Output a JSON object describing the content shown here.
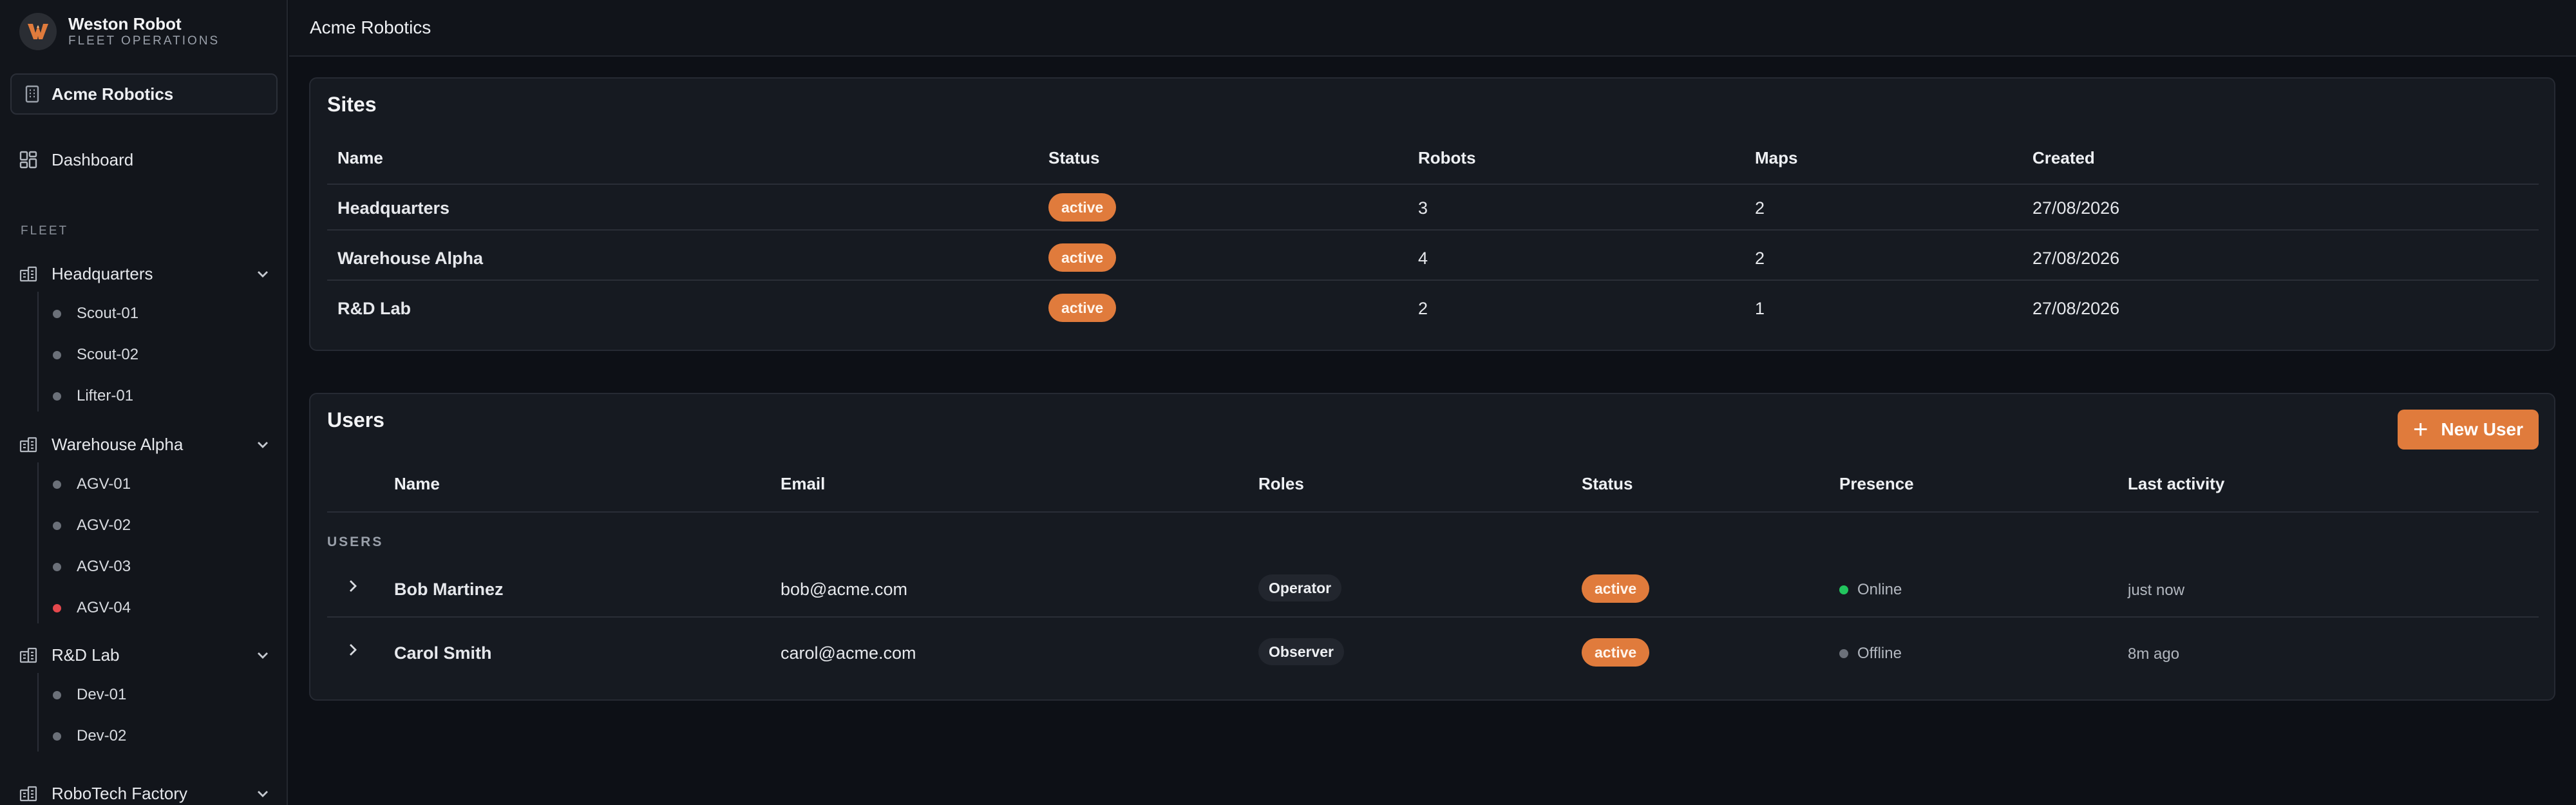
{
  "brand": {
    "name": "Weston Robot",
    "subtitle": "FLEET OPERATIONS",
    "logo_icon": "weston-logo-icon"
  },
  "org_switcher": {
    "label": "Acme Robotics",
    "icon": "building-icon"
  },
  "nav": {
    "dashboard": "Dashboard"
  },
  "sidebar": {
    "section_label": "FLEET",
    "groups": [
      {
        "label": "Headquarters",
        "robots": [
          {
            "label": "Scout-01",
            "status_color": "#6b7079"
          },
          {
            "label": "Scout-02",
            "status_color": "#6b7079"
          },
          {
            "label": "Lifter-01",
            "status_color": "#6b7079"
          }
        ]
      },
      {
        "label": "Warehouse Alpha",
        "robots": [
          {
            "label": "AGV-01",
            "status_color": "#6b7079"
          },
          {
            "label": "AGV-02",
            "status_color": "#6b7079"
          },
          {
            "label": "AGV-03",
            "status_color": "#6b7079"
          },
          {
            "label": "AGV-04",
            "status_color": "#e5484d"
          }
        ]
      },
      {
        "label": "R&D Lab",
        "robots": [
          {
            "label": "Dev-01",
            "status_color": "#6b7079"
          },
          {
            "label": "Dev-02",
            "status_color": "#6b7079"
          }
        ]
      },
      {
        "label": "RoboTech Factory",
        "robots": []
      }
    ]
  },
  "header": {
    "breadcrumb": "Acme Robotics"
  },
  "sites": {
    "title": "Sites",
    "columns": [
      "Name",
      "Status",
      "Robots",
      "Maps",
      "Created"
    ],
    "rows": [
      {
        "name": "Headquarters",
        "status": "active",
        "robots": "3",
        "maps": "2",
        "created": "27/08/2026"
      },
      {
        "name": "Warehouse Alpha",
        "status": "active",
        "robots": "4",
        "maps": "2",
        "created": "27/08/2026"
      },
      {
        "name": "R&D Lab",
        "status": "active",
        "robots": "2",
        "maps": "1",
        "created": "27/08/2026"
      }
    ]
  },
  "users": {
    "title": "Users",
    "new_user_label": "New User",
    "columns": [
      "Name",
      "Email",
      "Roles",
      "Status",
      "Presence",
      "Last activity"
    ],
    "group_label": "USERS",
    "rows": [
      {
        "name": "Bob Martinez",
        "email": "bob@acme.com",
        "role": "Operator",
        "status": "active",
        "presence": "Online",
        "presence_color": "#22c55e",
        "last_activity": "just now"
      },
      {
        "name": "Carol Smith",
        "email": "carol@acme.com",
        "role": "Observer",
        "status": "active",
        "presence": "Offline",
        "presence_color": "#6b7079",
        "last_activity": "8m ago"
      }
    ]
  },
  "colors": {
    "accent": "#e07b3c",
    "background": "#0d1016",
    "online": "#22c55e",
    "alert": "#e5484d"
  }
}
